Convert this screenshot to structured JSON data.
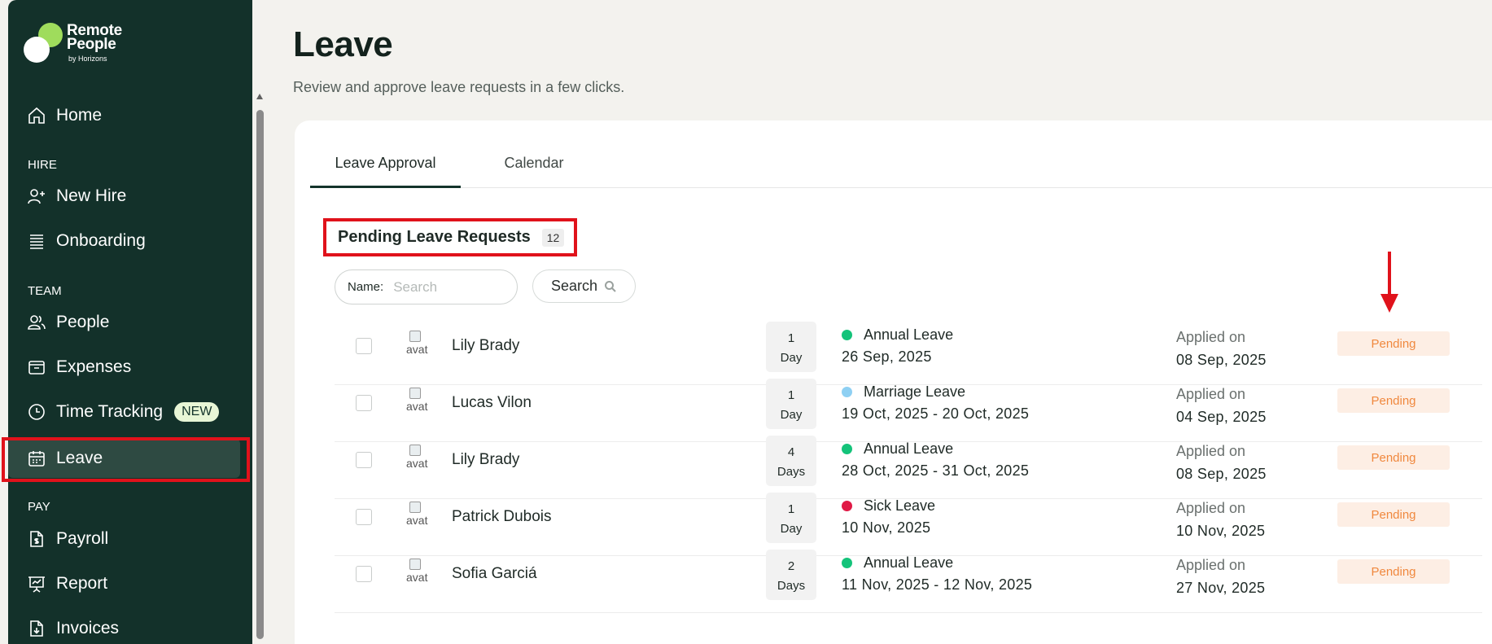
{
  "brand": {
    "line1": "Remote",
    "line2": "People",
    "sub": "by Horizons",
    "colors": {
      "sidebar": "#13312a",
      "accent_green": "#9fdc5c",
      "highlight_red": "#e0121b"
    }
  },
  "sidebar": {
    "items": [
      {
        "label": "Home",
        "icon": "home-icon"
      },
      {
        "section": "HIRE"
      },
      {
        "label": "New Hire",
        "icon": "user-plus-icon"
      },
      {
        "label": "Onboarding",
        "icon": "list-icon"
      },
      {
        "section": "TEAM"
      },
      {
        "label": "People",
        "icon": "users-icon"
      },
      {
        "label": "Expenses",
        "icon": "wallet-icon"
      },
      {
        "label": "Time Tracking",
        "icon": "clock-icon",
        "badge": "NEW"
      },
      {
        "label": "Leave",
        "icon": "calendar-icon",
        "active": true
      },
      {
        "section": "PAY"
      },
      {
        "label": "Payroll",
        "icon": "dollar-file-icon"
      },
      {
        "label": "Report",
        "icon": "presentation-icon"
      },
      {
        "label": "Invoices",
        "icon": "file-download-icon"
      }
    ]
  },
  "header": {
    "title": "Leave",
    "subtitle": "Review and approve leave requests in a few clicks."
  },
  "tabs": [
    {
      "label": "Leave Approval",
      "active": true
    },
    {
      "label": "Calendar",
      "active": false
    }
  ],
  "pending": {
    "title": "Pending Leave Requests",
    "count": "12"
  },
  "search": {
    "label": "Name:",
    "placeholder": "Search",
    "button": "Search"
  },
  "requests": [
    {
      "name": "Lily Brady",
      "avatar_alt": "avat",
      "days_n": "1",
      "days_unit": "Day",
      "type": "Annual Leave",
      "dot": "#14c37a",
      "dates": "26 Sep, 2025",
      "applied_label": "Applied on",
      "applied": "08 Sep, 2025",
      "status": "Pending"
    },
    {
      "name": "Lucas Vilon",
      "avatar_alt": "avat",
      "days_n": "1",
      "days_unit": "Day",
      "type": "Marriage Leave",
      "dot": "#8ed0f3",
      "dates": "19 Oct, 2025 - 20 Oct, 2025",
      "applied_label": "Applied on",
      "applied": "04 Sep, 2025",
      "status": "Pending"
    },
    {
      "name": "Lily Brady",
      "avatar_alt": "avat",
      "days_n": "4",
      "days_unit": "Days",
      "type": "Annual Leave",
      "dot": "#14c37a",
      "dates": "28 Oct, 2025 - 31 Oct, 2025",
      "applied_label": "Applied on",
      "applied": "08 Sep, 2025",
      "status": "Pending"
    },
    {
      "name": "Patrick Dubois",
      "avatar_alt": "avat",
      "days_n": "1",
      "days_unit": "Day",
      "type": "Sick Leave",
      "dot": "#e01945",
      "dates": "10 Nov, 2025",
      "applied_label": "Applied on",
      "applied": "10 Nov, 2025",
      "status": "Pending"
    },
    {
      "name": "Sofia Garciá",
      "avatar_alt": "avat",
      "days_n": "2",
      "days_unit": "Days",
      "type": "Annual Leave",
      "dot": "#14c37a",
      "dates": "11 Nov, 2025 - 12 Nov, 2025",
      "applied_label": "Applied on",
      "applied": "27 Nov, 2025",
      "status": "Pending"
    }
  ]
}
